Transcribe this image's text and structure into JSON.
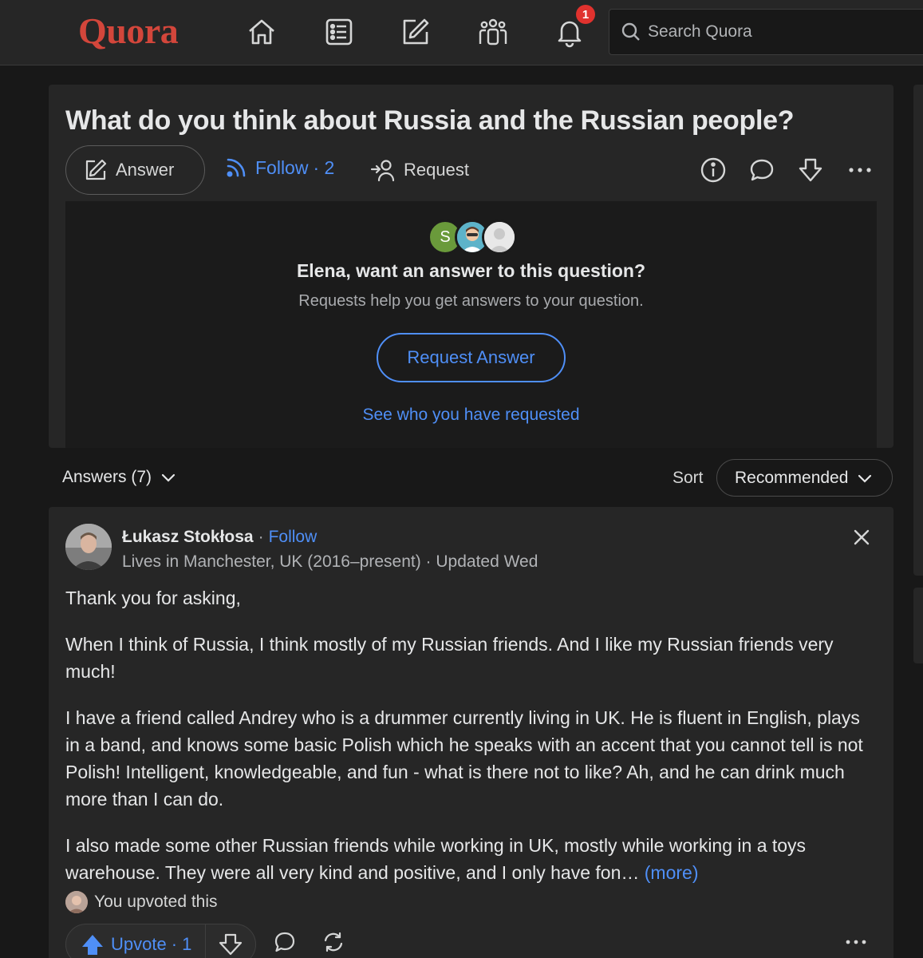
{
  "topbar": {
    "logo": "Quora",
    "notification_count": "1",
    "search_placeholder": "Search Quora"
  },
  "question": {
    "title": "What do you think about Russia and the Russian people?",
    "answer_label": "Answer",
    "follow_label": "Follow",
    "follow_count": "· 2",
    "request_label": "Request"
  },
  "request_panel": {
    "avatar_letter": "S",
    "heading": "Elena, want an answer to this question?",
    "subtext": "Requests help you get answers to your question.",
    "button": "Request Answer",
    "link": "See who you have requested"
  },
  "answers_header": {
    "label": "Answers (7)",
    "sort_label": "Sort",
    "sort_value": "Recommended"
  },
  "answer": {
    "author": "Łukasz Stokłosa",
    "follow": "Follow",
    "credential": "Lives in Manchester, UK (2016–present) · Updated Wed",
    "paragraphs": [
      "Thank you for asking,",
      "When I think of Russia, I think mostly of my Russian friends. And I like my Russian friends very much!",
      "I have a friend called Andrey who is a drummer currently living in UK. He is fluent in English, plays in a band, and knows some basic Polish which he speaks with an accent that you cannot tell is not Polish! Intelligent, knowledgeable, and fun - what is there not to like? Ah, and he can drink much more than I can do.",
      "I also made some other Russian friends while working in UK, mostly while working in a toys warehouse. They were all very kind and positive, and I only have fon… "
    ],
    "more": "(more)",
    "upvoted_text": "You upvoted this",
    "upvote_label": "Upvote",
    "upvote_count": "· 1"
  },
  "colors": {
    "accent": "#4f8ff7",
    "brand": "#d3463b",
    "badge": "#e0322e"
  }
}
